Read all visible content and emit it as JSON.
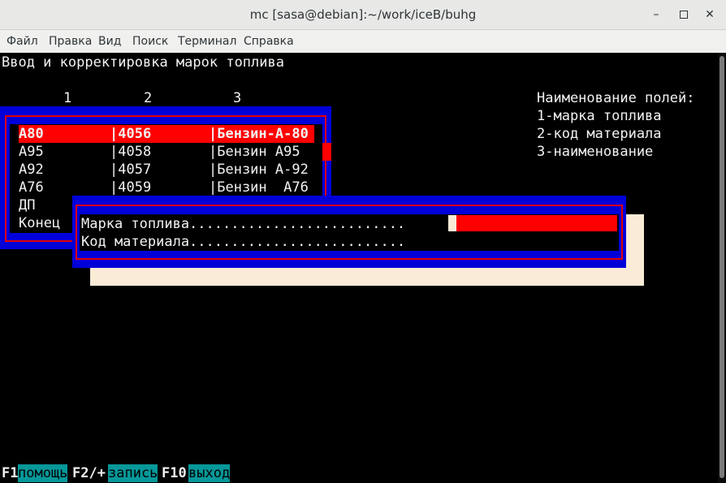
{
  "window": {
    "title": "mc [sasa@debian]:~/work/iceB/buhg",
    "buttons": [
      "minimize",
      "maximize",
      "close"
    ]
  },
  "menu": {
    "items": [
      "Файл",
      "Правка",
      "Вид",
      "Поиск",
      "Терминал",
      "Справка"
    ]
  },
  "screen": {
    "heading": "Ввод и корректировка марок топлива",
    "column_numbers": [
      "1",
      "2",
      "3"
    ],
    "legend": {
      "title": "Наименование полей:",
      "lines": [
        "1-марка топлива",
        "2-код материала",
        "3-наименование"
      ]
    }
  },
  "list": {
    "rows": [
      {
        "mark": "А80",
        "code": "|4056",
        "name": "|Бензин-А-80",
        "selected": true
      },
      {
        "mark": "А95",
        "code": "|4058",
        "name": "|Бензин А95",
        "selected": false
      },
      {
        "mark": "А92",
        "code": "|4057",
        "name": "|Бензин А-92",
        "selected": false
      },
      {
        "mark": "А76",
        "code": "|4059",
        "name": "|Бензин  А76",
        "selected": false
      },
      {
        "mark": "ДП",
        "code": "",
        "name": "",
        "selected": false
      },
      {
        "mark": "Конец",
        "code": "",
        "name": "",
        "selected": false
      }
    ]
  },
  "dialog": {
    "fields": [
      {
        "label": "Марка топлива..........................",
        "value": ""
      },
      {
        "label": "Код материала..........................",
        "value": ""
      }
    ]
  },
  "keys": [
    {
      "key": "F1",
      "label": "помощь"
    },
    {
      "key": "F2/+",
      "label": "запись"
    },
    {
      "key": "F10",
      "label": "выход"
    }
  ],
  "colors": {
    "terminal_bg": "#000000",
    "frame_blue": "#0000d8",
    "frame_red": "#e00000",
    "highlight_red": "#ff0000",
    "shadow_cream": "#faebd7",
    "key_cyan": "#06989a"
  }
}
